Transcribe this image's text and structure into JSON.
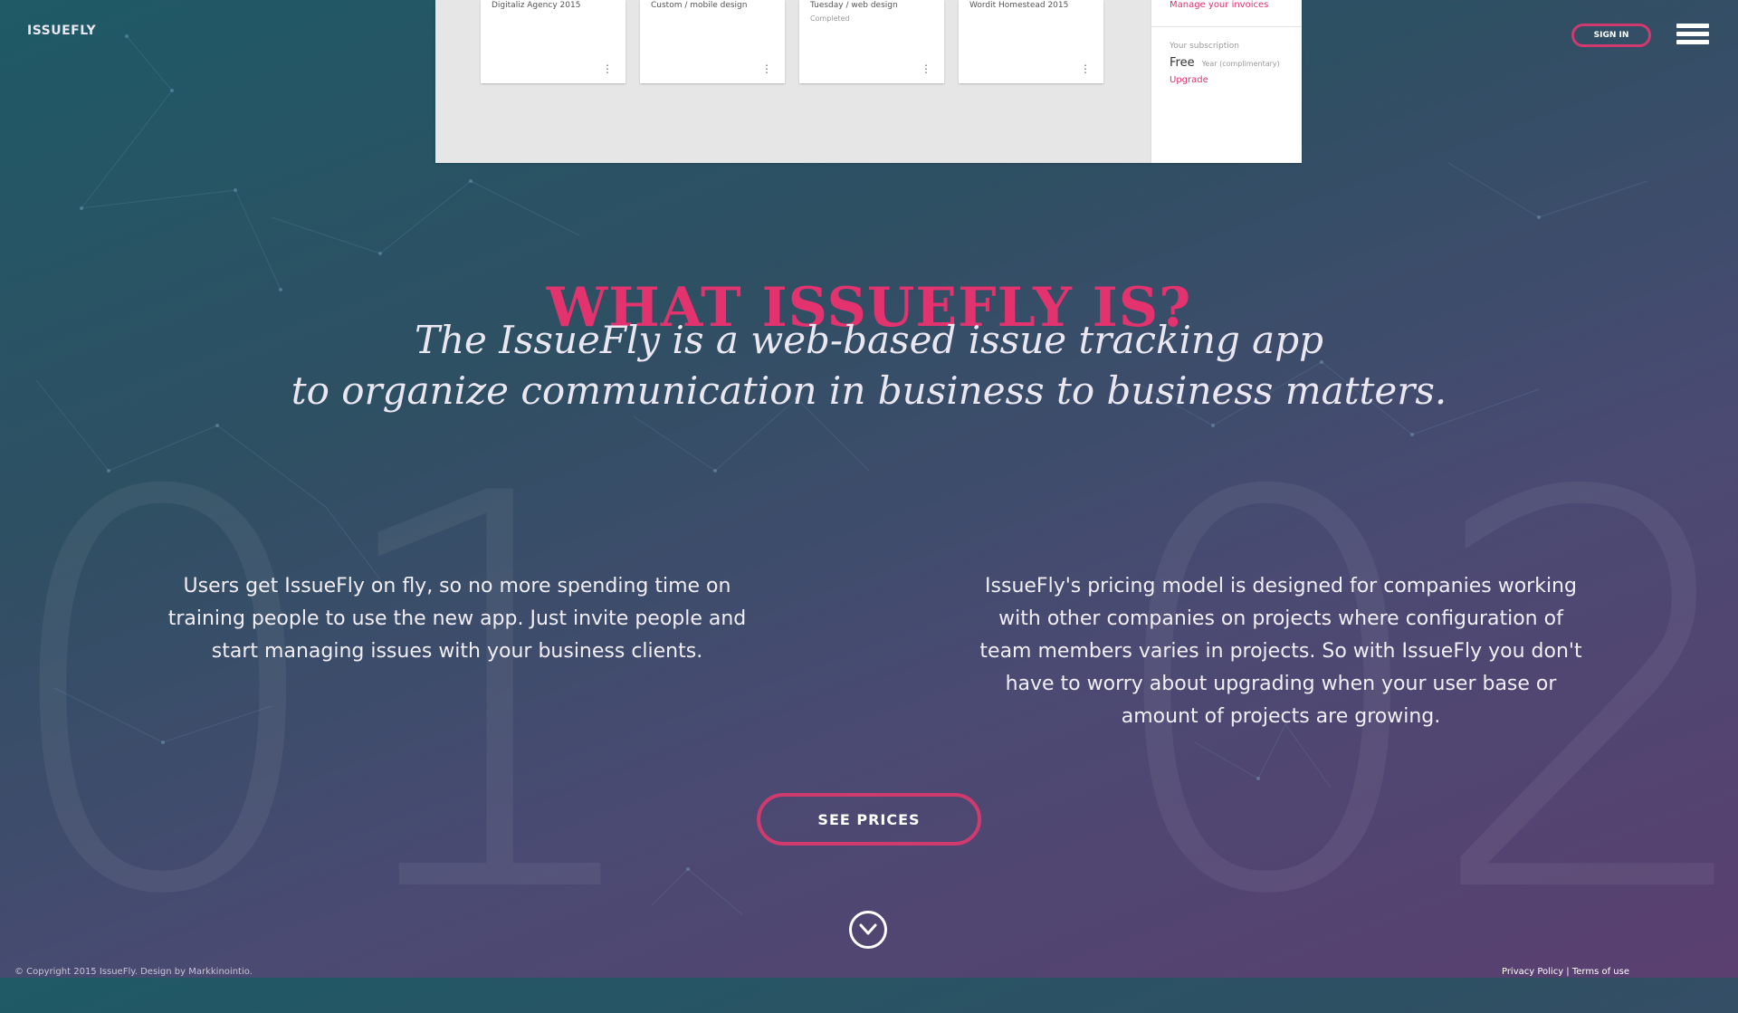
{
  "header": {
    "logo": "ISSUEFLY",
    "sign_in_label": "SIGN IN",
    "menu_icon": "hamburger-menu-icon"
  },
  "preview": {
    "cards": [
      {
        "title": "Digitaliz Agency 2015",
        "subtitle": ""
      },
      {
        "title": "Custom / mobile design",
        "subtitle": ""
      },
      {
        "title": "Tuesday / web design",
        "subtitle": "Completed"
      },
      {
        "title": "Wordit Homestead 2015",
        "subtitle": ""
      }
    ],
    "side": {
      "manage_link": "Manage your invoices",
      "subscription_label": "Your subscription",
      "plan": "Free",
      "plan_note": "Year (complimentary)",
      "upgrade_link": "Upgrade"
    }
  },
  "main": {
    "title": "WHAT ISSUEFLY IS?",
    "subtitle_line1": "The IssueFly is a web-based issue tracking app",
    "subtitle_line2": "to organize communication in business to business matters.",
    "bg_number_1": "01",
    "bg_number_2": "02",
    "column_1": "Users get IssueFly on fly, so no more spending time on training people to use the new app. Just invite people and start managing issues with your business clients.",
    "column_2": "IssueFly's pricing model is designed for companies working with other companies on projects where configuration of team members varies in projects. So with IssueFly you don't have to worry about upgrading when your user base or amount of projects are growing.",
    "cta_label": "SEE PRICES",
    "scroll_icon": "chevron-down-circle-icon"
  },
  "footer": {
    "copyright": "© Copyright 2015 IssueFly. Design by Markkinointio.",
    "legal": "Privacy Policy | Terms of use"
  },
  "colors": {
    "accent": "#e2336f",
    "button_border": "#d13a6e",
    "gradient_start": "#1f5a66",
    "gradient_end": "#5a3f70"
  }
}
